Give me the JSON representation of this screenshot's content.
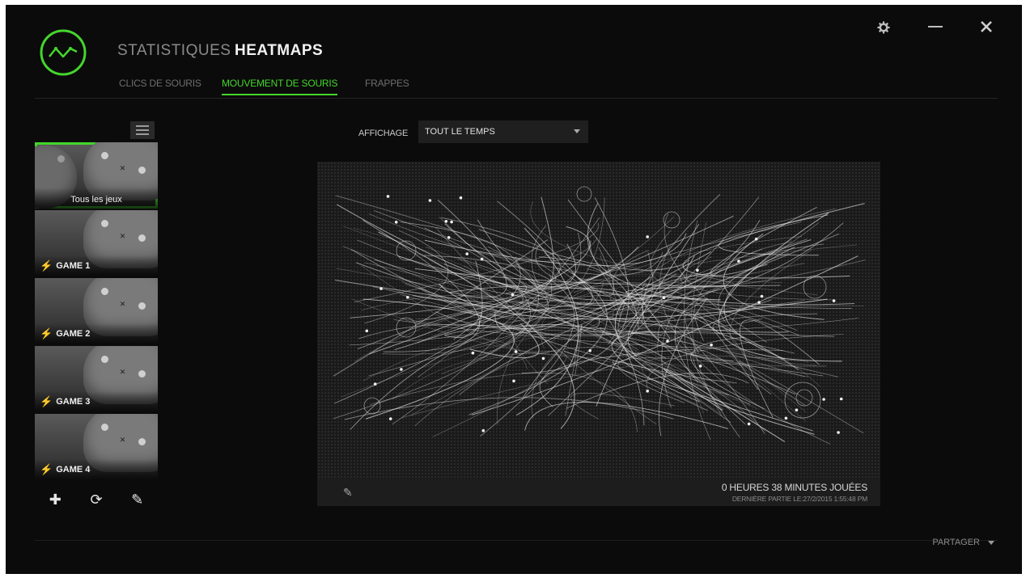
{
  "colors": {
    "accent": "#44d62c",
    "background": "#0b0b0b"
  },
  "nav": {
    "main_tabs": [
      {
        "label": "STATISTIQUES",
        "active": false
      },
      {
        "label": "HEATMAPS",
        "active": true
      }
    ],
    "sub_tabs": [
      {
        "label": "CLICS DE SOURIS",
        "active": false
      },
      {
        "label": "MOUVEMENT DE SOURIS",
        "active": true
      },
      {
        "label": "FRAPPES",
        "active": false
      }
    ]
  },
  "window_controls": {
    "settings_icon": "gear-icon",
    "minimize_icon": "minimize-icon",
    "close_icon": "close-icon"
  },
  "sidebar": {
    "menu_icon": "hamburger-icon",
    "games": [
      {
        "label": "Tous les jeux",
        "selected": true
      },
      {
        "label": "GAME 1",
        "selected": false
      },
      {
        "label": "GAME 2",
        "selected": false
      },
      {
        "label": "GAME 3",
        "selected": false
      },
      {
        "label": "GAME 4",
        "selected": false
      }
    ],
    "actions": {
      "add_icon": "plus-icon",
      "refresh_icon": "refresh-icon",
      "edit_icon": "pencil-icon"
    }
  },
  "display": {
    "label": "AFFICHAGE",
    "selected": "TOUT LE TEMPS"
  },
  "heatmap": {
    "played": "0 HEURES 38 MINUTES JOUÉES",
    "last_played": "DERNIÈRE PARTIE LE:27/2/2015 1:55:48 PM",
    "edit_icon": "pencil-icon"
  },
  "share": {
    "label": "PARTAGER"
  }
}
